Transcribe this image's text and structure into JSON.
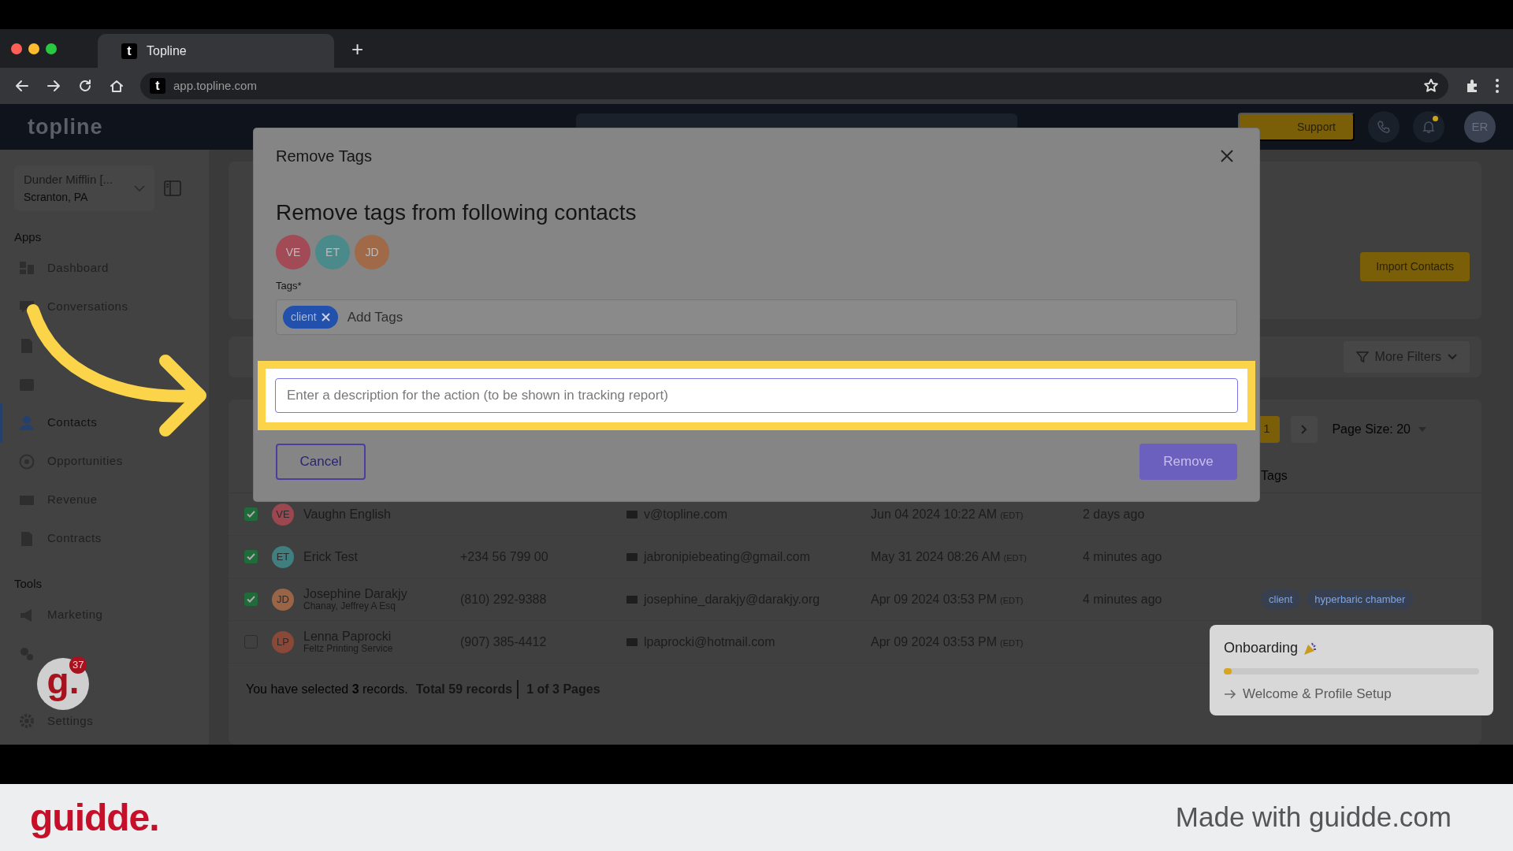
{
  "browser": {
    "tab_favicon": "t",
    "tab_title": "Topline",
    "new_tab": "+",
    "url_favicon": "t",
    "url": "app.topline.com"
  },
  "header": {
    "logo": "topline",
    "support_button": "Support",
    "notification_dot": true,
    "avatar": "ER"
  },
  "sidebar": {
    "account": {
      "name": "Dunder Mifflin [...",
      "location": "Scranton, PA"
    },
    "sections": [
      {
        "title": "Apps",
        "items": [
          {
            "label": "Dashboard",
            "selected": false
          },
          {
            "label": "Conversations",
            "selected": false
          },
          {
            "selected": false
          },
          {
            "selected": false
          },
          {
            "label": "Contacts",
            "selected": true
          },
          {
            "label": "Opportunities",
            "selected": false
          },
          {
            "label": "Revenue",
            "selected": false
          },
          {
            "label": "Contracts",
            "selected": false
          }
        ]
      },
      {
        "title": "Tools",
        "items": [
          {
            "label": "Marketing",
            "selected": false
          },
          {
            "selected": false
          }
        ]
      }
    ],
    "settings": "Settings"
  },
  "contacts": {
    "import_button": "Import Contacts",
    "filters_button": "More Filters",
    "page": "1",
    "page_size": "Page Size: 20",
    "tags_header": "Tags",
    "rows": [
      {
        "selected": true,
        "initials": "VE",
        "color": "#9c4650",
        "name": "Vaughn English",
        "email": "v@topline.com",
        "date": "Jun 04 2024 10:22 AM",
        "timezone": "(EDT)",
        "ago": "2 days ago"
      },
      {
        "selected": true,
        "initials": "ET",
        "color": "#3f7f80",
        "name": "Erick Test",
        "phone": "+234 56 799 00",
        "email": "jabronipiebeating@gmail.com",
        "date": "May 31 2024 08:26 AM",
        "timezone": "(EDT)",
        "ago": "4 minutes ago"
      },
      {
        "selected": true,
        "initials": "JD",
        "color": "#9a6446",
        "name": "Josephine Darakjy",
        "company": "Chanay, Jeffrey A Esq",
        "phone": "(810) 292-9388",
        "email": "josephine_darakjy@darakjy.org",
        "date": "Apr 09 2024 03:53 PM",
        "timezone": "(EDT)",
        "ago": "4 minutes ago",
        "tags": [
          "client",
          "hyperbaric chamber"
        ]
      },
      {
        "selected": false,
        "initials": "LP",
        "color": "#8a4838",
        "name": "Lenna Paprocki",
        "company": "Feltz Printing Service",
        "phone": "(907) 385-4412",
        "email": "lpaprocki@hotmail.com",
        "date": "Apr 09 2024 03:53 PM",
        "timezone": "(EDT)"
      }
    ],
    "selection_note": "You have selected **3** records.",
    "total": "Total 59 records",
    "pages": "1 of 3 Pages"
  },
  "modal": {
    "title": "Remove Tags",
    "heading": "Remove tags from following contacts",
    "contacts": [
      {
        "initials": "VE",
        "color": "#a24a55"
      },
      {
        "initials": "ET",
        "color": "#4a8a8a"
      },
      {
        "initials": "JD",
        "color": "#a06a48"
      }
    ],
    "tags_label": "Tags*",
    "tags": [
      "client"
    ],
    "tags_placeholder": "Add Tags",
    "action_placeholder": "Enter a description for the action (to be shown in tracking report)",
    "cancel": "Cancel",
    "remove": "Remove"
  },
  "onboarding": {
    "title": "Onboarding",
    "level": 0.03,
    "step": "Welcome & Profile Setup"
  },
  "helper_badge": {
    "logo": "g.",
    "count": "37"
  },
  "footer": {
    "logo": "guidde.",
    "credit": "Made with guidde.com"
  }
}
